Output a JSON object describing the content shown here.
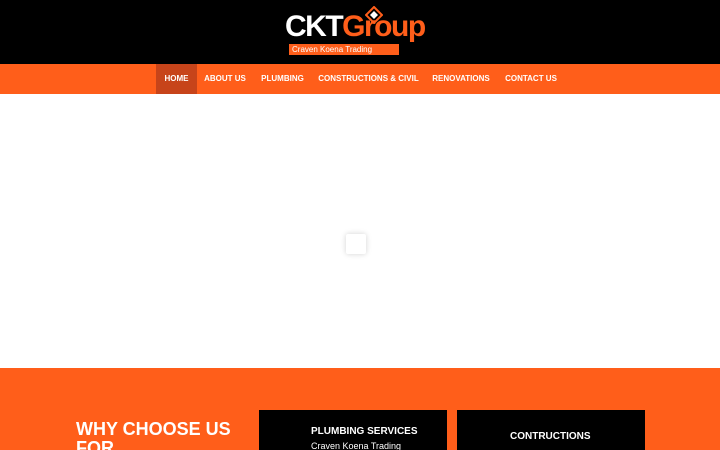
{
  "header": {
    "logo": {
      "main_left": "CKT",
      "main_right": "Group",
      "tagline": "Craven Koena Trading"
    }
  },
  "nav": {
    "items": [
      {
        "label": "HOME",
        "active": true
      },
      {
        "label": "ABOUT US",
        "active": false
      },
      {
        "label": "PLUMBING",
        "active": false
      },
      {
        "label": "CONSTRUCTIONS & CIVIL",
        "active": false
      },
      {
        "label": "RENOVATIONS",
        "active": false
      },
      {
        "label": "CONTACT US",
        "active": false
      }
    ]
  },
  "services": {
    "heading": "WHY CHOOSE US FOR",
    "cards": [
      {
        "title": "PLUMBING SERVICES",
        "text": "Craven Koena Trading"
      },
      {
        "title": "CONTRUCTIONS",
        "text": ""
      }
    ]
  },
  "colors": {
    "brand_orange": "#ff5e1a",
    "nav_active": "#c7441a",
    "header_bg": "#000000"
  }
}
